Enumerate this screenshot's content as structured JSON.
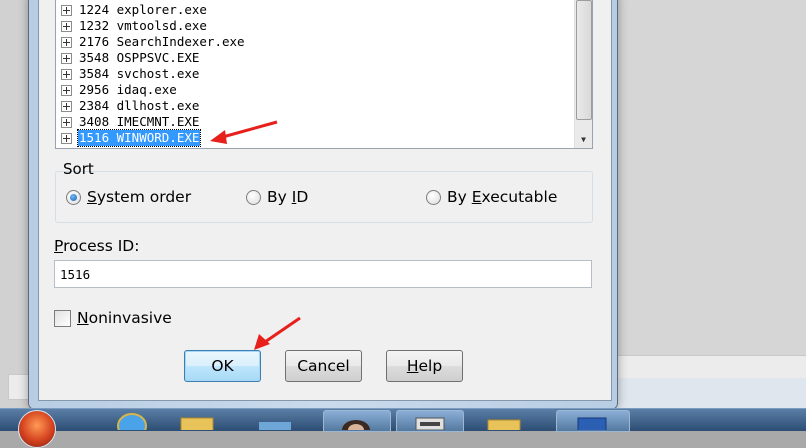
{
  "process_list": {
    "items": [
      {
        "pid": "1224",
        "name": "explorer.exe",
        "selected": false
      },
      {
        "pid": "1232",
        "name": "vmtoolsd.exe",
        "selected": false
      },
      {
        "pid": "2176",
        "name": "SearchIndexer.exe",
        "selected": false
      },
      {
        "pid": "3548",
        "name": "OSPPSVC.EXE",
        "selected": false
      },
      {
        "pid": "3584",
        "name": "svchost.exe",
        "selected": false
      },
      {
        "pid": "2956",
        "name": "idaq.exe",
        "selected": false
      },
      {
        "pid": "2384",
        "name": "dllhost.exe",
        "selected": false
      },
      {
        "pid": "3408",
        "name": "IMECMNT.EXE",
        "selected": false
      },
      {
        "pid": "1516",
        "name": "WINWORD.EXE",
        "selected": true
      }
    ],
    "labels": [
      "1224 explorer.exe",
      "1232 vmtoolsd.exe",
      "2176 SearchIndexer.exe",
      "3548 OSPPSVC.EXE",
      "3584 svchost.exe",
      "2956 idaq.exe",
      "2384 dllhost.exe",
      "3408 IMECMNT.EXE",
      "1516 WINWORD.EXE"
    ]
  },
  "sort": {
    "title": "Sort",
    "options": [
      {
        "prefix": "",
        "accel": "S",
        "suffix": "ystem order",
        "checked": true
      },
      {
        "prefix": "By ",
        "accel": "I",
        "suffix": "D",
        "checked": false
      },
      {
        "prefix": "By ",
        "accel": "E",
        "suffix": "xecutable",
        "checked": false
      }
    ]
  },
  "process_id": {
    "label_accel": "P",
    "label_rest": "rocess ID:",
    "value": "1516"
  },
  "noninvasive": {
    "accel": "N",
    "rest": "oninvasive",
    "checked": false
  },
  "buttons": {
    "ok": "OK",
    "cancel": "Cancel",
    "help_accel": "H",
    "help_rest": "elp"
  },
  "colors": {
    "selection": "#3399ff",
    "annotation_arrow": "#e8201c"
  }
}
